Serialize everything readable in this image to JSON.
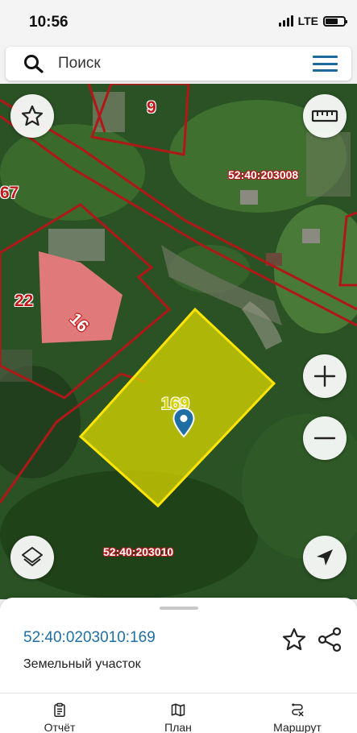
{
  "status_bar": {
    "time": "10:56",
    "network": "LTE"
  },
  "search": {
    "placeholder": "Поиск"
  },
  "map": {
    "quarter_labels": [
      "52:40:203008",
      "52:40:203010"
    ],
    "parcel_numbers": [
      "9",
      "67",
      "22",
      "16",
      "169"
    ]
  },
  "selected_object": {
    "cadastral_number": "52:40:0203010:169",
    "type": "Земельный участок"
  },
  "bottom_nav": {
    "items": [
      {
        "label": "Отчёт",
        "icon": "clipboard-icon"
      },
      {
        "label": "План",
        "icon": "map-icon"
      },
      {
        "label": "Маршрут",
        "icon": "route-icon"
      }
    ]
  },
  "colors": {
    "accent": "#1f6fa4",
    "parcel_border": "#b01818",
    "selected_fill": "#d4d200",
    "selected_border": "#ffe500"
  }
}
